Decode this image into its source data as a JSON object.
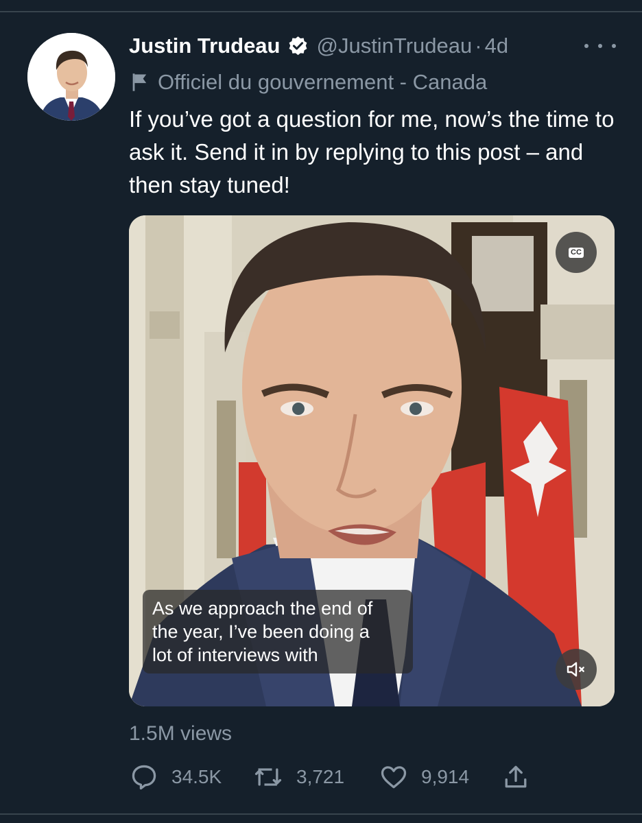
{
  "tweet": {
    "author_name": "Justin Trudeau",
    "handle": "@JustinTrudeau",
    "separator": "·",
    "time": "4d",
    "label": "Officiel du gouvernement - Canada",
    "text": "If you’ve got a question for me, now’s the time to ask it. Send it in by replying to this post – and then stay tuned!"
  },
  "video": {
    "cc_label": "CC",
    "caption_lines": [
      "As we approach the end of",
      "the year, I’ve been  doing a",
      "lot of interviews with"
    ]
  },
  "stats": {
    "views": "1.5M views",
    "replies": "34.5K",
    "retweets": "3,721",
    "likes": "9,914"
  },
  "icons": {
    "verified": "verified-badge-icon",
    "label": "flag-icon",
    "more": "more-dots-icon",
    "cc": "closed-captions-icon",
    "mute": "muted-speaker-icon",
    "reply": "reply-bubble-icon",
    "retweet": "retweet-icon",
    "like": "heart-icon",
    "share": "share-icon"
  },
  "colors": {
    "background": "#15202b",
    "text_primary": "#ffffff",
    "text_secondary": "#8b98a5",
    "divider": "#38444d"
  }
}
